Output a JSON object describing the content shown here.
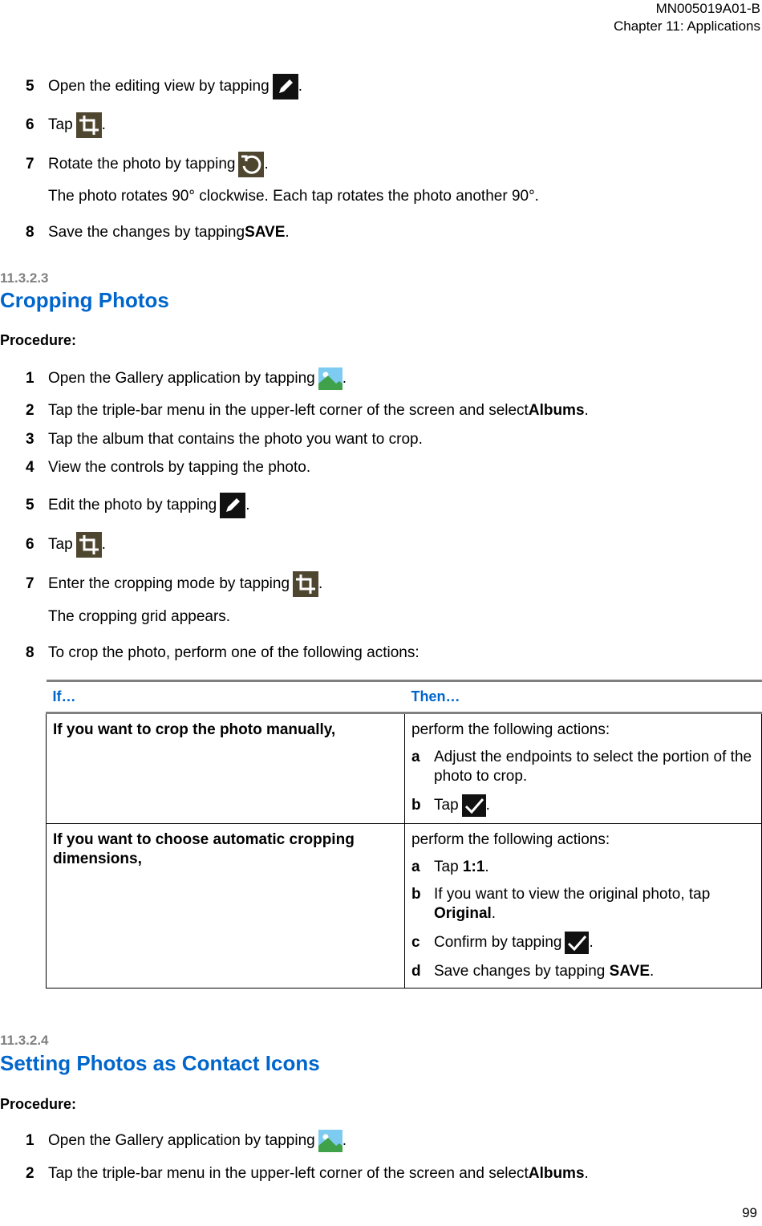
{
  "header": {
    "doc_id": "MN005019A01-B",
    "chapter": "Chapter 11:  Applications"
  },
  "top_steps": [
    {
      "num": "5",
      "text": "Open the editing view by tapping",
      "icon": "pencil-icon",
      "after": "."
    },
    {
      "num": "6",
      "text": "Tap",
      "icon": "crop-icon",
      "after": "."
    },
    {
      "num": "7",
      "text": "Rotate the photo by tapping",
      "icon": "rotate-icon",
      "after": ".",
      "note": "The photo rotates 90° clockwise. Each tap rotates the photo another 90°."
    },
    {
      "num": "8",
      "text": "Save the changes by tapping ",
      "bold": "SAVE",
      "after": "."
    }
  ],
  "section1": {
    "number": "11.3.2.3",
    "title": "Cropping Photos",
    "procedure_label": "Procedure:",
    "steps": [
      {
        "num": "1",
        "text": "Open the Gallery application by tapping",
        "icon": "gallery-icon",
        "after": "."
      },
      {
        "num": "2",
        "text": "Tap the triple-bar menu in the upper-left corner of the screen and select ",
        "bold": "Albums",
        "after": "."
      },
      {
        "num": "3",
        "text": "Tap the album that contains the photo you want to crop."
      },
      {
        "num": "4",
        "text": "View the controls by tapping the photo."
      },
      {
        "num": "5",
        "text": "Edit the photo by tapping",
        "icon": "pencil-icon",
        "after": "."
      },
      {
        "num": "6",
        "text": "Tap",
        "icon": "crop-icon",
        "after": "."
      },
      {
        "num": "7",
        "text": "Enter the cropping mode by tapping",
        "icon": "crop-icon",
        "after": ".",
        "note": "The cropping grid appears."
      },
      {
        "num": "8",
        "text": "To crop the photo, perform one of the following actions:"
      }
    ],
    "table": {
      "headers": [
        "If…",
        "Then…"
      ],
      "rows": [
        {
          "if": "If you want to crop the photo manually,",
          "then_intro": "perform the following actions:",
          "actions": [
            {
              "letter": "a",
              "text": "Adjust the endpoints to select the portion of the photo to crop."
            },
            {
              "letter": "b",
              "text": "Tap",
              "icon": "checkmark-icon",
              "after": "."
            }
          ]
        },
        {
          "if": "If you want to choose automatic cropping dimensions,",
          "then_intro": "perform the following actions:",
          "actions": [
            {
              "letter": "a",
              "text": "Tap ",
              "bold": "1:1",
              "after": "."
            },
            {
              "letter": "b",
              "text": "If you want to view the original photo, tap ",
              "bold": "Original",
              "after": "."
            },
            {
              "letter": "c",
              "text": "Confirm by tapping",
              "icon": "checkmark-icon",
              "after": "."
            },
            {
              "letter": "d",
              "text": "Save changes by tapping ",
              "bold": "SAVE",
              "after": "."
            }
          ]
        }
      ]
    }
  },
  "section2": {
    "number": "11.3.2.4",
    "title": "Setting Photos as Contact Icons",
    "procedure_label": "Procedure:",
    "steps": [
      {
        "num": "1",
        "text": "Open the Gallery application by tapping",
        "icon": "gallery-icon",
        "after": "."
      },
      {
        "num": "2",
        "text": "Tap the triple-bar menu in the upper-left corner of the screen and select ",
        "bold": "Albums",
        "after": "."
      }
    ]
  },
  "page_number": "99"
}
